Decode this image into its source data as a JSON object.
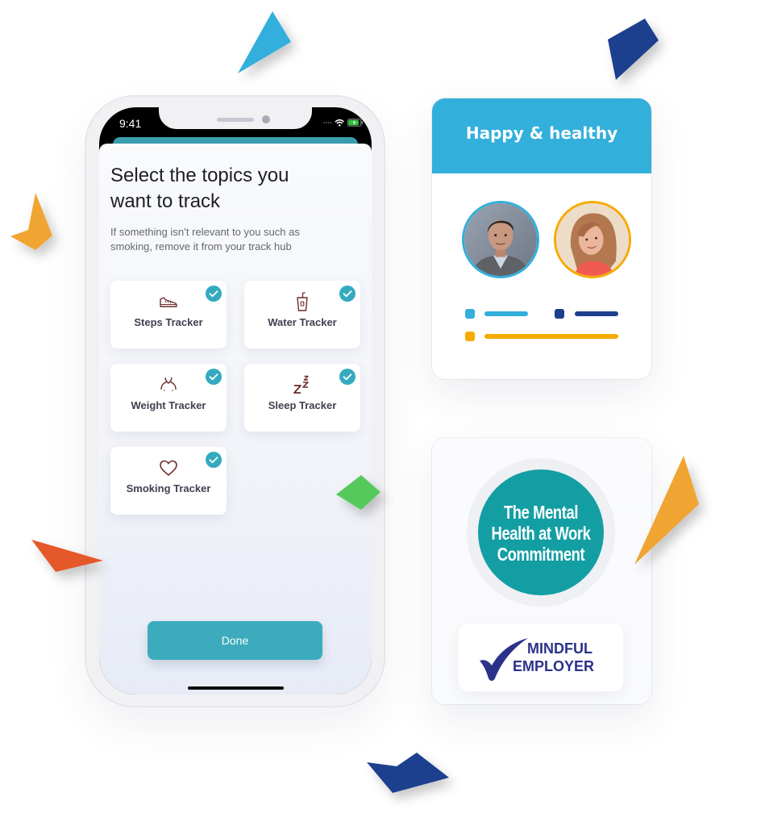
{
  "colors": {
    "accent_teal": "#3cabbe",
    "check_badge": "#35aabf",
    "icon_stroke": "#6d2b2b",
    "happy_header": "#33afdc",
    "mh_teal": "#139ea3",
    "mindful_navy": "#2c3189"
  },
  "phone": {
    "status_time": "9:41"
  },
  "screen": {
    "title": [
      "Select the topics you",
      "want to track"
    ],
    "subtitle": [
      "If something isn’t relevant to you such as",
      "smoking, remove it from your track hub"
    ],
    "trackers": [
      {
        "label": "Steps Tracker",
        "icon": "shoe-icon",
        "checked": true
      },
      {
        "label": "Water Tracker",
        "icon": "water-glass-icon",
        "checked": true
      },
      {
        "label": "Weight Tracker",
        "icon": "body-icon",
        "checked": true
      },
      {
        "label": "Sleep Tracker",
        "icon": "sleep-zzz-icon",
        "checked": true
      },
      {
        "label": "Smoking Tracker",
        "icon": "heart-icon",
        "checked": true
      }
    ],
    "done_label": "Done"
  },
  "happy_card": {
    "title": "Happy & healthy",
    "avatars": [
      {
        "border_color": "#33afdc"
      },
      {
        "border_color": "#f5ab00"
      }
    ],
    "legend": [
      {
        "color": "#33afdc"
      },
      {
        "color": "#1d3f8e"
      },
      {
        "color": "#f5ab00"
      }
    ]
  },
  "badges": {
    "mental_health": [
      "The Mental",
      "Health at Work",
      "Commitment"
    ],
    "mindful_employer": [
      "MINDFUL",
      "EMPLOYER"
    ]
  },
  "decorations": [
    {
      "name": "cyan-shard",
      "color": "#33afdc"
    },
    {
      "name": "navy-shard-top",
      "color": "#1d3f8e"
    },
    {
      "name": "orange-shard-left",
      "color": "#f0a431"
    },
    {
      "name": "red-shard",
      "color": "#e5592a"
    },
    {
      "name": "green-diamond",
      "color": "#57c95d"
    },
    {
      "name": "orange-shard-right",
      "color": "#f0a431"
    },
    {
      "name": "navy-shard-bottom",
      "color": "#1d3f8e"
    }
  ]
}
